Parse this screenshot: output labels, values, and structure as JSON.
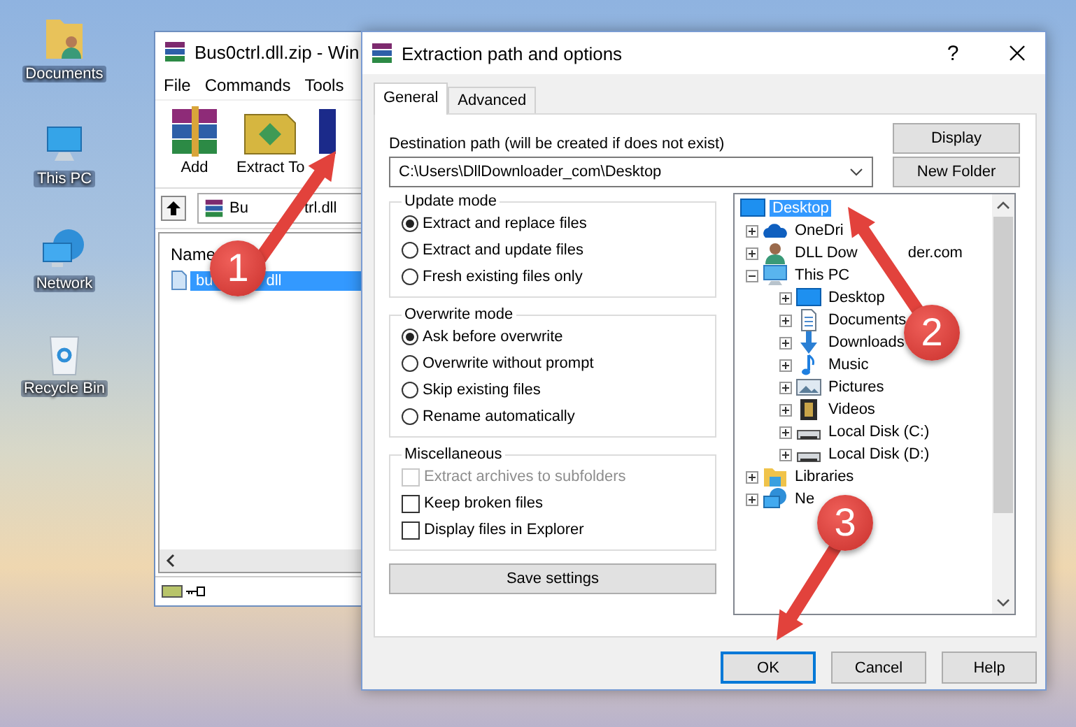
{
  "desktop_icons": [
    {
      "label": "Documents",
      "kind": "documents"
    },
    {
      "label": "This PC",
      "kind": "pc"
    },
    {
      "label": "Network",
      "kind": "network"
    },
    {
      "label": "Recycle Bin",
      "kind": "recycle"
    }
  ],
  "archiver_window": {
    "title": "Bus0ctrl.dll.zip - Win",
    "menu": [
      "File",
      "Commands",
      "Tools"
    ],
    "toolbar": [
      {
        "label": "Add",
        "kind": "add"
      },
      {
        "label": "Extract To",
        "kind": "extract"
      },
      {
        "kind": "book"
      }
    ],
    "address": {
      "label": "Bu",
      "label_after": "trl.dll"
    },
    "columns": [
      "Name"
    ],
    "files": [
      {
        "label": "bu",
        "label_after": "dll",
        "selected": true
      }
    ]
  },
  "dialog": {
    "title": "Extraction path and options",
    "help": "?",
    "tabs": [
      {
        "label": "General",
        "selected": true
      },
      {
        "label": "Advanced",
        "selected": false
      }
    ],
    "destination": {
      "label": "Destination path (will be created if does not exist)",
      "value": "C:\\Users\\DllDownloader_com\\Desktop"
    },
    "side_buttons": [
      "Display",
      "New Folder"
    ],
    "groups": [
      {
        "title": "Update mode",
        "kind": "radio",
        "options": [
          {
            "label": "Extract and replace files",
            "selected": true
          },
          {
            "label": "Extract and update files",
            "selected": false
          },
          {
            "label": "Fresh existing files only",
            "selected": false
          }
        ]
      },
      {
        "title": "Overwrite mode",
        "kind": "radio",
        "options": [
          {
            "label": "Ask before overwrite",
            "selected": true
          },
          {
            "label": "Overwrite without prompt",
            "selected": false
          },
          {
            "label": "Skip existing files",
            "selected": false
          },
          {
            "label": "Rename automatically",
            "selected": false
          }
        ]
      },
      {
        "title": "Miscellaneous",
        "kind": "checkbox",
        "options": [
          {
            "label": "Extract archives to subfolders",
            "checked": false,
            "disabled": true
          },
          {
            "label": "Keep broken files",
            "checked": false,
            "disabled": false
          },
          {
            "label": "Display files in Explorer",
            "checked": false,
            "disabled": false
          }
        ]
      }
    ],
    "save_button": "Save settings",
    "tree": {
      "label": "Desktop",
      "kind": "monitor",
      "selected": true,
      "children": [
        {
          "label": "OneDri",
          "kind": "cloud",
          "selected": false,
          "expanded": false
        },
        {
          "label": "DLL Dow",
          "label_after": "der.com",
          "kind": "user",
          "selected": false,
          "expanded": false
        },
        {
          "label": "This PC",
          "kind": "pc",
          "selected": false,
          "expanded": true,
          "children": [
            {
              "label": "Desktop",
              "kind": "monitor",
              "selected": false,
              "expanded": false
            },
            {
              "label": "Documents",
              "kind": "document",
              "selected": false,
              "expanded": false
            },
            {
              "label": "Downloads",
              "kind": "download",
              "selected": false,
              "expanded": false
            },
            {
              "label": "Music",
              "kind": "music",
              "selected": false,
              "expanded": false
            },
            {
              "label": "Pictures",
              "kind": "picture",
              "selected": false,
              "expanded": false
            },
            {
              "label": "Videos",
              "kind": "video",
              "selected": false,
              "expanded": false
            },
            {
              "label": "Local Disk (C:)",
              "kind": "disk",
              "selected": false,
              "expanded": false
            },
            {
              "label": "Local Disk (D:)",
              "kind": "disk",
              "selected": false,
              "expanded": false
            }
          ]
        },
        {
          "label": "Libraries",
          "kind": "library",
          "selected": false,
          "expanded": false
        },
        {
          "label": "Ne",
          "kind": "network",
          "selected": false,
          "expanded": false
        }
      ]
    },
    "buttons": [
      {
        "label": "OK",
        "default": true
      },
      {
        "label": "Cancel",
        "default": false
      },
      {
        "label": "Help",
        "default": false
      }
    ]
  },
  "annotations": [
    {
      "label": "1"
    },
    {
      "label": "2"
    },
    {
      "label": "3"
    }
  ]
}
